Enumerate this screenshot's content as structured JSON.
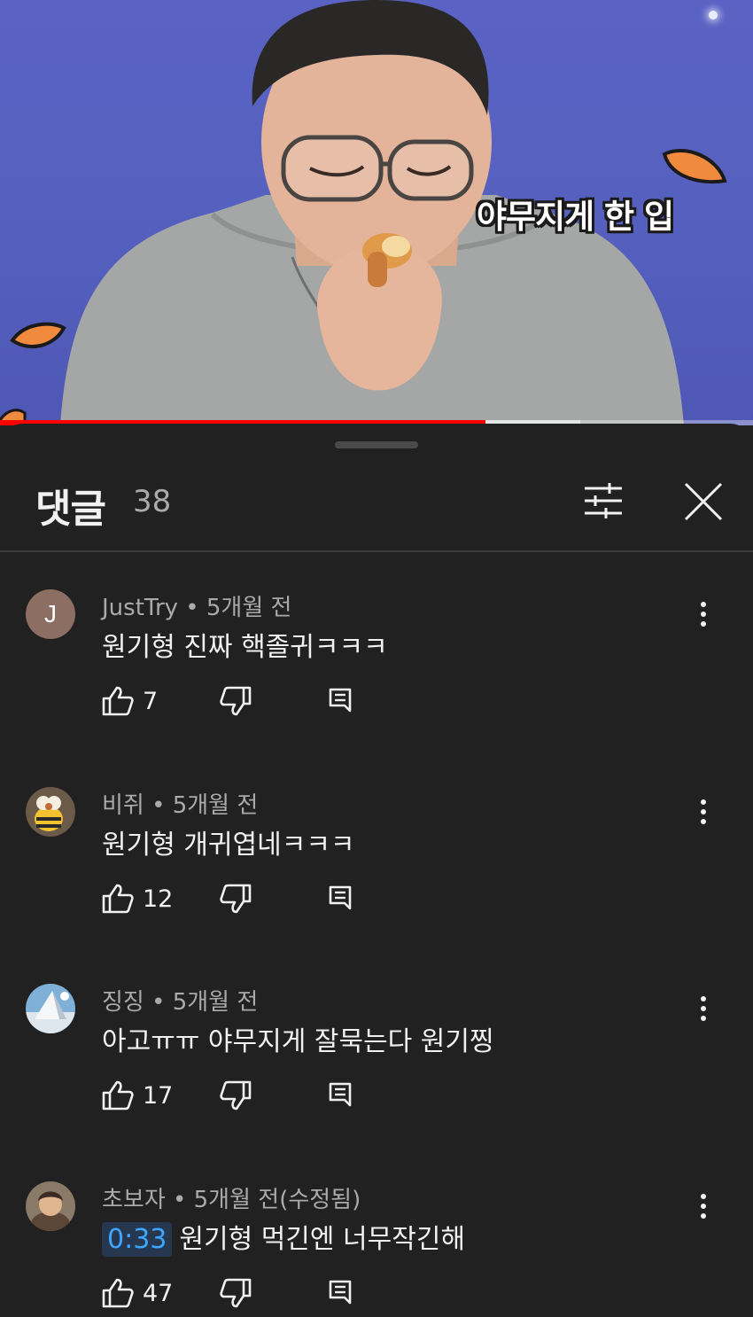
{
  "video": {
    "caption": "야무지게 한 입",
    "progress_fraction": 0.645,
    "buffered_fraction": 0.77
  },
  "comments_panel": {
    "title": "댓글",
    "count": "38",
    "icons": {
      "filter": "sort-filter-icon",
      "close": "close-icon"
    },
    "comments": [
      {
        "avatar": "J",
        "meta": "JustTry • 5개월 전",
        "text": "원기형 진짜 핵졸귀ㅋㅋㅋ",
        "timestamp": "",
        "likes": "7"
      },
      {
        "avatar": "",
        "meta": "비쥐 • 5개월 전",
        "text": "원기형 개귀엽네ㅋㅋㅋ",
        "timestamp": "",
        "likes": "12"
      },
      {
        "avatar": "",
        "meta": "징징 • 5개월 전",
        "text": "아고ㅠㅠ 야무지게 잘묵는다 원기찡",
        "timestamp": "",
        "likes": "17"
      },
      {
        "avatar": "",
        "meta": "초보자 • 5개월 전(수정됨)",
        "text": "원기형 먹긴엔  너무작긴해",
        "timestamp": "0:33",
        "likes": "47"
      }
    ]
  },
  "colors": {
    "background": "#212121",
    "text_primary": "#f1f1f1",
    "text_secondary": "#aaaaaa",
    "progress": "#ff0000",
    "timestamp_link": "#3ea6ff"
  }
}
